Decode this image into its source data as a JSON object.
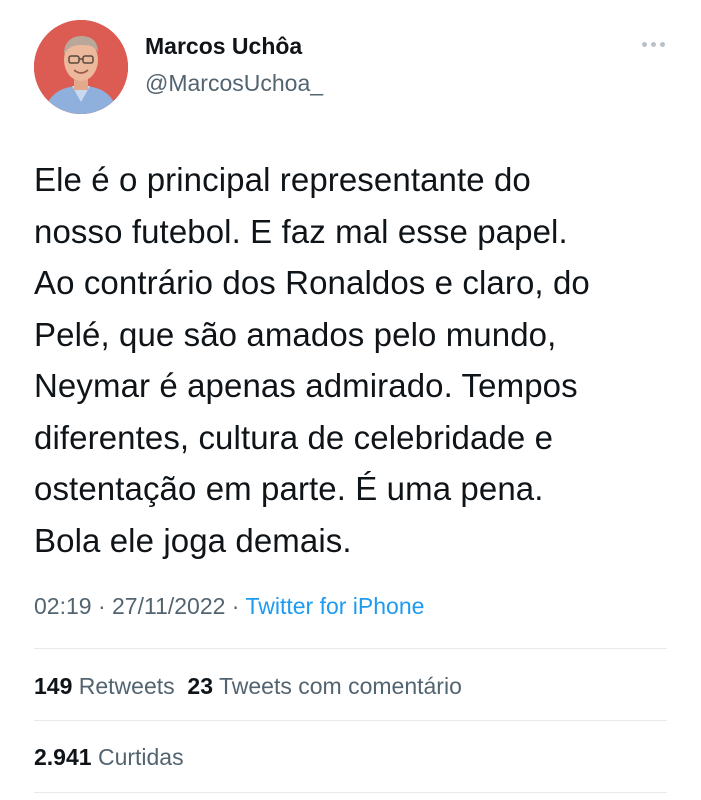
{
  "author": {
    "name": "Marcos Uchôa",
    "handle": "@MarcosUchoa_",
    "avatar_icon": "profile-photo"
  },
  "tweet": {
    "text": "Ele é o principal representante do\nnosso futebol. E faz mal esse papel.\nAo contrário dos Ronaldos e claro, do\nPelé, que são amados pelo mundo,\nNeymar é apenas admirado. Tempos\ndiferentes, cultura de celebridade e\nostentação em parte. É uma pena.\nBola ele joga demais.",
    "time": "02:19",
    "separator1": " · ",
    "date": "27/11/2022",
    "separator2": " · ",
    "source": "Twitter for iPhone"
  },
  "stats": {
    "retweets_count": "149",
    "retweets_label": "Retweets",
    "quotes_count": "23",
    "quotes_label": "Tweets com comentário",
    "likes_count": "2.941",
    "likes_label": "Curtidas"
  },
  "colors": {
    "primary_text": "#0f1419",
    "secondary_text": "#536471",
    "link": "#1d9bf0",
    "divider": "#e7ebee"
  }
}
